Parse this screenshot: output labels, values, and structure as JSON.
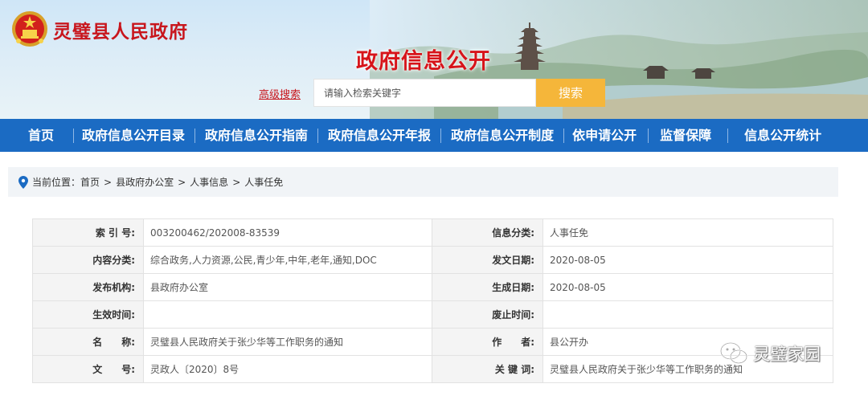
{
  "header": {
    "site_title": "灵璧县人民政府",
    "section_title": "政府信息公开",
    "advanced_search": "高级搜索",
    "search_placeholder": "请输入检索关键字",
    "search_button": "搜索",
    "accent_red": "#c8161d",
    "button_color": "#f5b63a"
  },
  "nav": {
    "color": "#1b6bc3",
    "items": [
      {
        "label": "首页"
      },
      {
        "label": "政府信息公开目录"
      },
      {
        "label": "政府信息公开指南"
      },
      {
        "label": "政府信息公开年报"
      },
      {
        "label": "政府信息公开制度"
      },
      {
        "label": "依申请公开"
      },
      {
        "label": "监督保障"
      },
      {
        "label": "信息公开统计"
      }
    ]
  },
  "breadcrumb": {
    "prefix": "当前位置：",
    "items": [
      "首页",
      "县政府办公室",
      "人事信息",
      "人事任免"
    ]
  },
  "meta": {
    "rows": [
      {
        "l1": "索 引 号:",
        "v1": "003200462/202008-83539",
        "l2": "信息分类:",
        "v2": "人事任免"
      },
      {
        "l1": "内容分类:",
        "v1": "综合政务,人力资源,公民,青少年,中年,老年,通知,DOC",
        "l2": "发文日期:",
        "v2": "2020-08-05"
      },
      {
        "l1": "发布机构:",
        "v1": "县政府办公室",
        "l2": "生成日期:",
        "v2": "2020-08-05"
      },
      {
        "l1": "生效时间:",
        "v1": "",
        "l2": "废止时间:",
        "v2": ""
      },
      {
        "l1": "名　　称:",
        "v1": "灵璧县人民政府关于张少华等工作职务的通知",
        "l2": "作　　者:",
        "v2": "县公开办"
      },
      {
        "l1": "文　　号:",
        "v1": "灵政人〔2020〕8号",
        "l2": "关 键 词:",
        "v2": "灵璧县人民政府关于张少华等工作职务的通知"
      }
    ]
  },
  "watermark": {
    "text": "灵璧家园",
    "icon": "wechat-icon"
  }
}
